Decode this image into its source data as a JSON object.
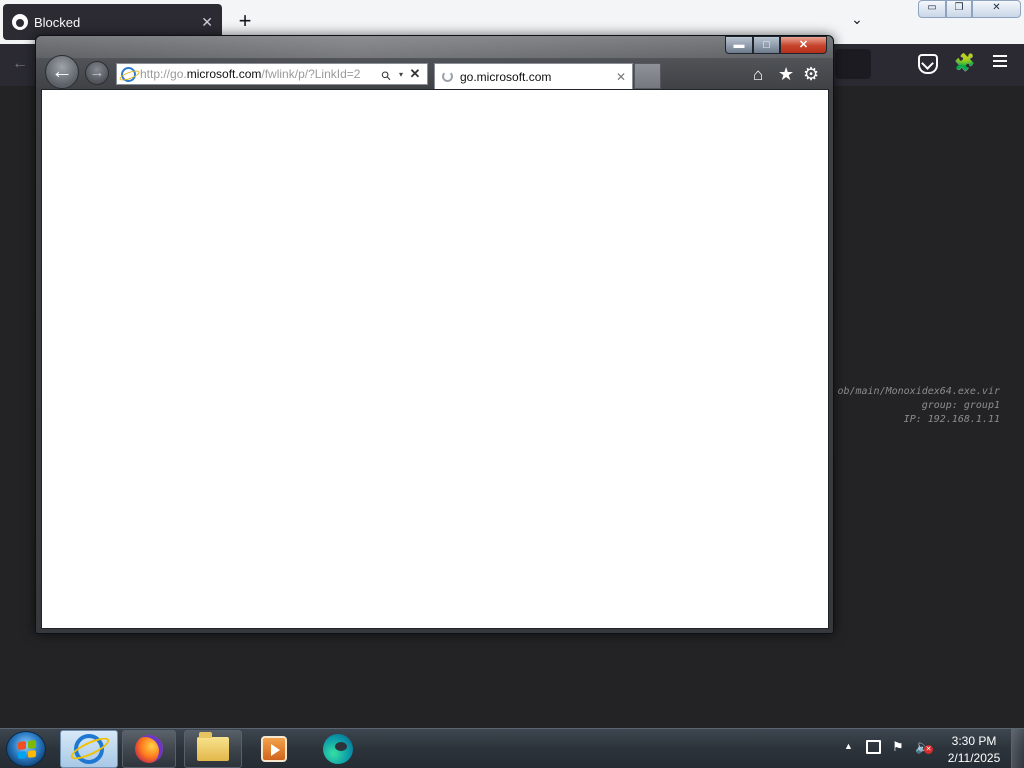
{
  "firefox": {
    "tab_title": "Blocked",
    "tab_close": "✕",
    "new_tab": "+",
    "list_all_tabs": "⌄",
    "window_minimize": "▭",
    "window_restore": "❐",
    "window_close": "✕",
    "nav_back": "←",
    "extensions_icon": "🧩"
  },
  "background_text": {
    "lines": [
      "ob/main/Monoxidex64.exe.vir",
      "group: group1",
      "IP: 192.168.1.11"
    ]
  },
  "ie": {
    "caption_minimize": "▬",
    "caption_maximize": "□",
    "caption_close": "✕",
    "back": "←",
    "forward": "→",
    "address": {
      "prefix": "http://go.",
      "domain": "microsoft.com",
      "suffix": "/fwlink/p/?LinkId=2"
    },
    "search_icon": "⚲",
    "dropdown_icon": "▾",
    "stop_icon": "✕",
    "tab_title": "go.microsoft.com",
    "tab_close": "✕",
    "home_icon": "⌂",
    "favorites_icon": "★",
    "tools_icon": "⚙"
  },
  "taskbar": {
    "pinned": [
      "internet-explorer",
      "firefox",
      "windows-explorer",
      "media-player",
      "edge"
    ],
    "tray_arrow": "▲",
    "tray_flag": "⚑",
    "tray_volume": "🔈",
    "tray_volume_muted": "✕",
    "clock_time": "3:30 PM",
    "clock_date": "2/11/2025"
  },
  "colors": {
    "start_flag": [
      "#f25022",
      "#7fba00",
      "#00a4ef",
      "#ffb900"
    ]
  }
}
